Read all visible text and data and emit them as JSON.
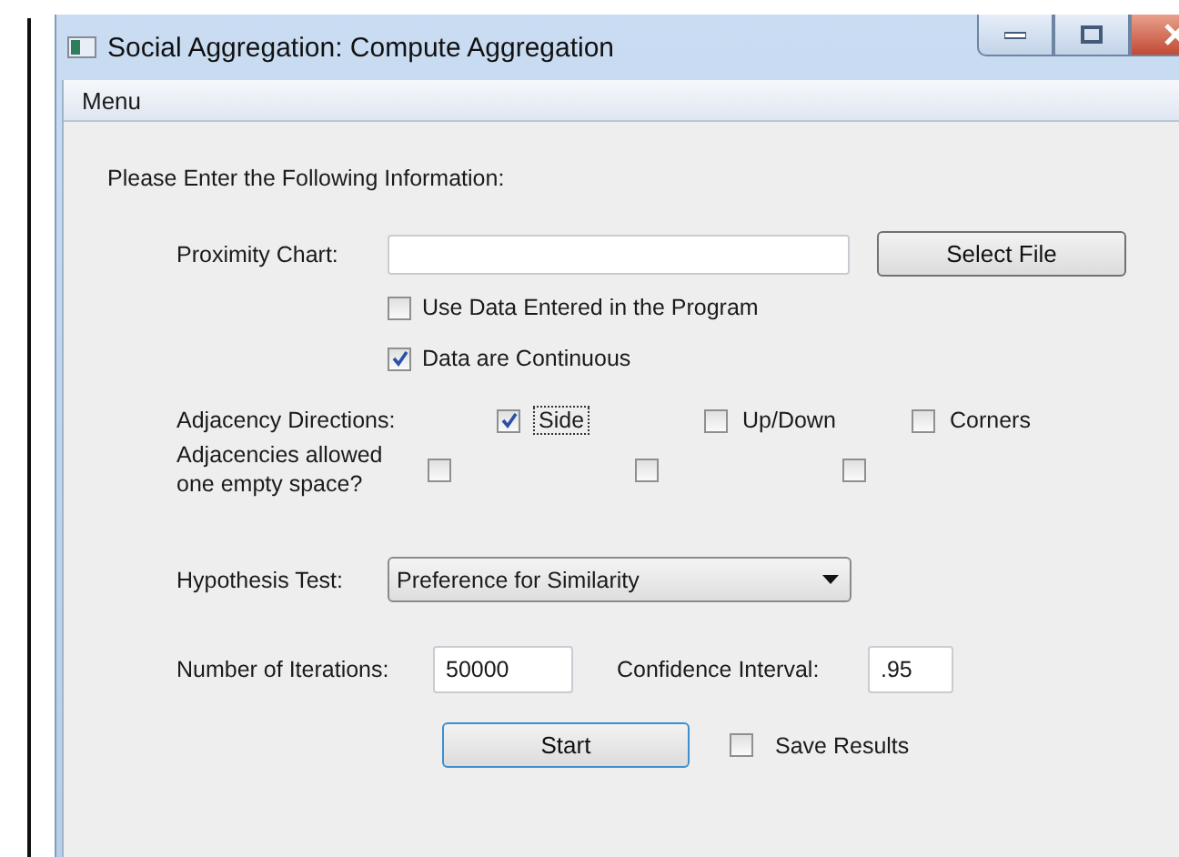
{
  "window": {
    "title": "Social Aggregation: Compute Aggregation"
  },
  "menu": [
    "Menu"
  ],
  "form": {
    "heading": "Please Enter the Following Information:",
    "proximity_chart": {
      "label": "Proximity Chart:",
      "button": "Select File"
    },
    "options": [
      {
        "label": "Use Data Entered in the Program",
        "checked": false
      },
      {
        "label": "Data are Continuous",
        "checked": true
      }
    ],
    "adjacency_directions": {
      "label": "Adjacency Directions:",
      "options": [
        {
          "label": "Side",
          "checked": true,
          "focused": true
        },
        {
          "label": "Up/Down",
          "checked": false,
          "focused": false
        },
        {
          "label": "Corners",
          "checked": false,
          "focused": false
        }
      ]
    },
    "empty_space": {
      "label": "Adjacencies allowed one empty space?",
      "options": [
        {
          "checked": false
        },
        {
          "checked": false
        },
        {
          "checked": false
        }
      ]
    },
    "hypothesis_test": {
      "label": "Hypothesis Test:",
      "value": "Preference for Similarity"
    },
    "iterations": {
      "label": "Number of Iterations:",
      "value": "50000"
    },
    "confidence_interval": {
      "label": "Confidence Interval:",
      "value": ".95"
    },
    "start_button": "Start",
    "save_results": {
      "label": "Save Results",
      "checked": false
    }
  }
}
